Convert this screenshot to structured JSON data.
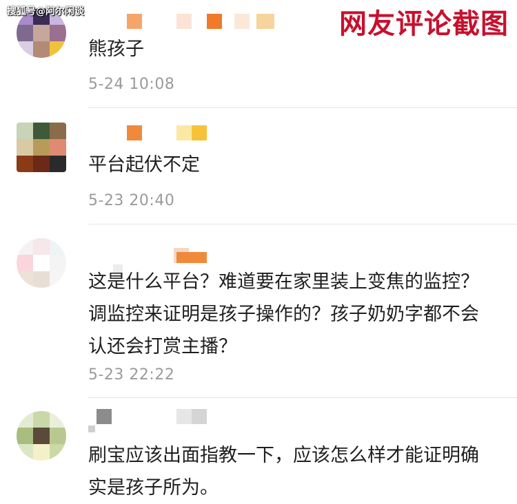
{
  "watermark": "搜狐号@阿尔闲谈",
  "stamp": "网友评论截图",
  "colors": {
    "stamp": "#c8102e",
    "time": "#9a9a9a",
    "divider": "#e6e6e6"
  },
  "comments": [
    {
      "text": "熊孩子",
      "time": "5-24 10:08"
    },
    {
      "text": "平台起伏不定",
      "time": "5-23 20:40"
    },
    {
      "text": "这是什么平台？难道要在家里装上变焦的监控？调监控来证明是孩子操作的？孩子奶奶字都不会认还会打赏主播？",
      "time": "5-23 22:22"
    },
    {
      "text": "刷宝应该出面指教一下，应该怎么样才能证明确实是孩子所为。",
      "time": ""
    }
  ]
}
